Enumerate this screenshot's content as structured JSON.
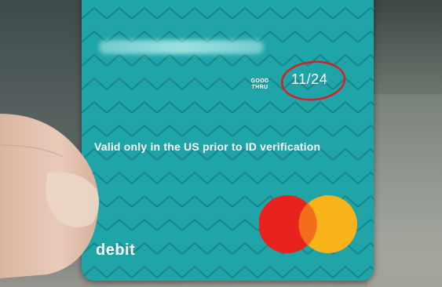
{
  "card": {
    "good_thru_label": "GOOD\nTHRU",
    "good_thru_line1": "GOOD",
    "good_thru_line2": "THRU",
    "expiry": "11/24",
    "validity_note": "Valid only in the US prior to ID verification",
    "card_type": "debit",
    "network_logo": "mastercard-logo",
    "card_color": "#1fa5a8",
    "annotation_color": "#d42027"
  }
}
